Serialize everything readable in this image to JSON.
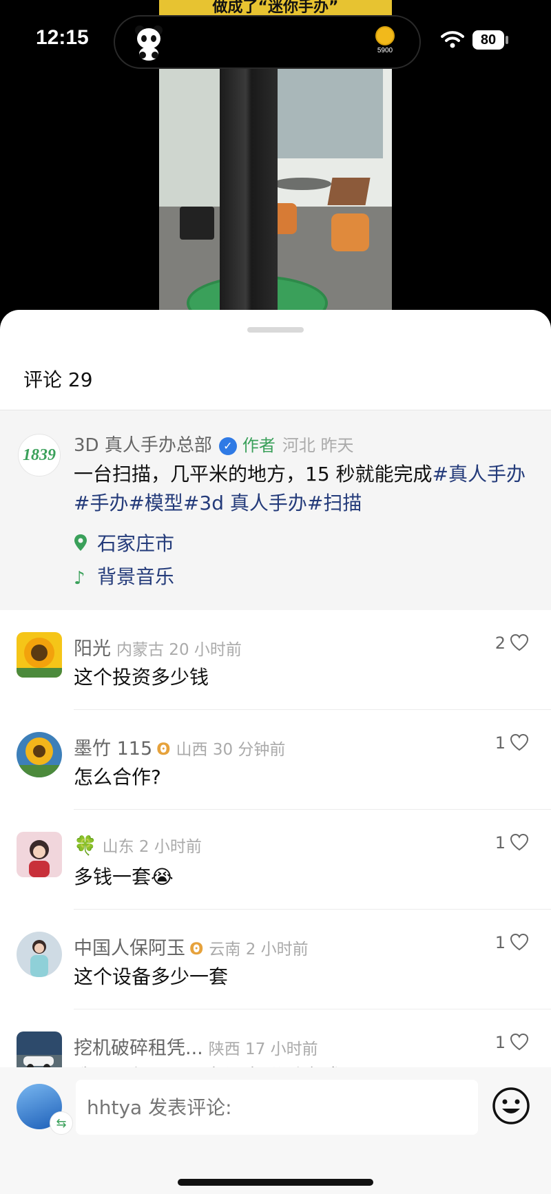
{
  "status_bar": {
    "time": "12:15",
    "coin_value": "5900",
    "battery": "80"
  },
  "video": {
    "banner_text": "做成了“迷你手办”"
  },
  "comments_header": {
    "title": "评论 29"
  },
  "post": {
    "author": "3D 真人手办总部",
    "author_tag": "作者",
    "location_time": "河北 昨天",
    "text": "一台扫描，几平米的地方，15 秒就能完成",
    "hashtags": "#真人手办#手办#模型#3d 真人手办#扫描",
    "location": "石家庄市",
    "music": "背景音乐",
    "avatar_text": "1839"
  },
  "comments": [
    {
      "name": "阳光",
      "meta": "内蒙古 20 小时前",
      "text": "这个投资多少钱",
      "likes": "2"
    },
    {
      "name": "墨竹 115",
      "badge": "ʘ",
      "meta": "山西 30 分钟前",
      "text": "怎么合作?",
      "likes": "1"
    },
    {
      "name": "🍀",
      "meta": "山东 2 小时前",
      "text": "多钱一套😭",
      "likes": "1"
    },
    {
      "name": "中国人保阿玉",
      "badge": "ʘ",
      "meta": "云南 2 小时前",
      "text": "这个设备多少一套",
      "likes": "1"
    },
    {
      "name": "挖机破碎租凭...",
      "meta": "陕西 17 小时前",
      "text": "我可以加盟吗? 有没有联系方式?",
      "likes": "1"
    }
  ],
  "input": {
    "placeholder": "hhtya 发表评论:"
  },
  "colors": {
    "accent_green": "#3aa05a",
    "link_blue": "#243b7a",
    "verify_blue": "#2f7ae5"
  }
}
